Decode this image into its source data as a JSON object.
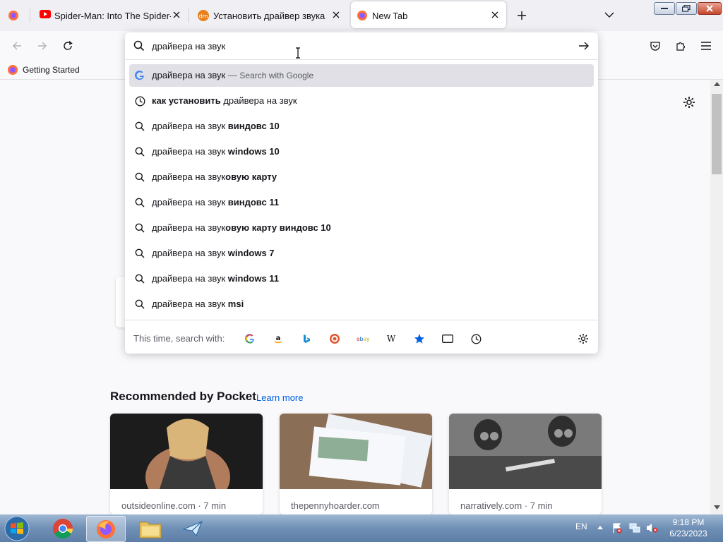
{
  "tabs": [
    {
      "title": "Spider-Man: Into The Spider-Verse",
      "icon": "youtube-icon"
    },
    {
      "title": "Установить драйвер звука",
      "icon": "dm-site-icon"
    },
    {
      "title": "New Tab",
      "icon": "firefox-icon",
      "active": true
    }
  ],
  "urlbar": {
    "value": "драйвера на звук"
  },
  "bookmarks": [
    {
      "label": "Getting Started",
      "icon": "firefox-icon"
    }
  ],
  "suggestions": {
    "google_row": {
      "query": "драйвера на звук",
      "dash": "—",
      "suffix": "Search with Google"
    },
    "history_row": {
      "bold": "как установить",
      "rest": " драйвера на звук"
    },
    "items": [
      {
        "plain": "драйвера на звук ",
        "bold": "виндовс 10"
      },
      {
        "plain": "драйвера на звук ",
        "bold": "windows 10"
      },
      {
        "plain": "драйвера на звук",
        "bold": "овую карту"
      },
      {
        "plain": "драйвера на звук ",
        "bold": "виндовс 11"
      },
      {
        "plain": "драйвера на звук",
        "bold": "овую карту виндовс 10"
      },
      {
        "plain": "драйвера на звук ",
        "bold": "windows 7"
      },
      {
        "plain": "драйвера на звук ",
        "bold": "windows 11"
      },
      {
        "plain": "драйвера на звук ",
        "bold": "msi"
      }
    ],
    "one_offs_label": "This time, search with:",
    "engines": [
      "google-icon",
      "amazon-icon",
      "bing-icon",
      "duckduckgo-icon",
      "ebay-icon",
      "wikipedia-icon",
      "bookmarks-star-icon",
      "tabs-icon",
      "history-icon"
    ]
  },
  "pocket": {
    "heading": "Recommended by Pocket",
    "learn_more": "Learn more",
    "cards": [
      {
        "source": "outsideonline.com · 7 min"
      },
      {
        "source": "thepennyhoarder.com"
      },
      {
        "source": "narratively.com · 7 min"
      }
    ]
  },
  "taskbar": {
    "lang": "EN",
    "time": "9:18 PM",
    "date": "6/23/2023"
  },
  "colors": {
    "accent": "#0061e0",
    "link": "#0060df",
    "selected_row": "#e0e0e6"
  }
}
